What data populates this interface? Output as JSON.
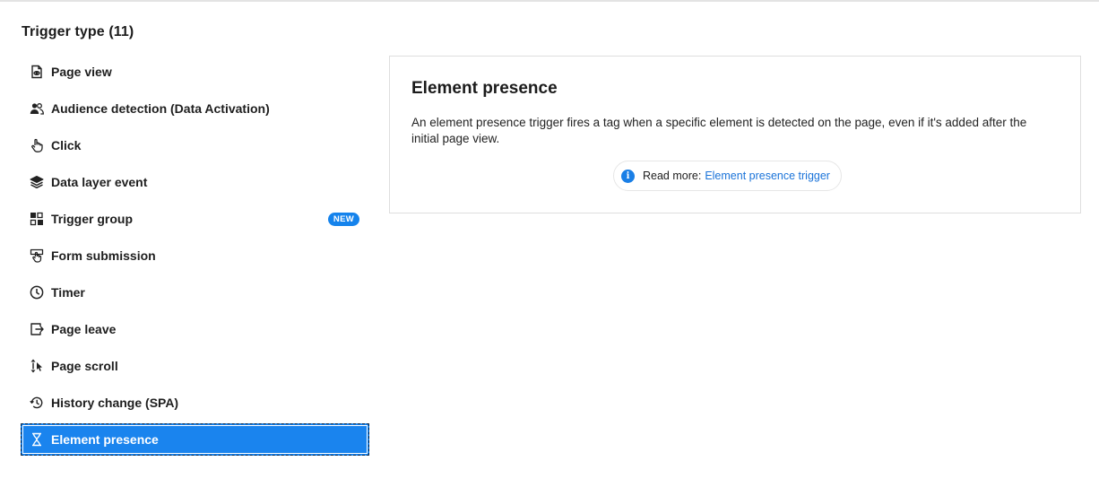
{
  "header": {
    "title": "Trigger type (11)"
  },
  "triggers": [
    {
      "label": "Page view",
      "icon": "page-view-icon",
      "selected": false
    },
    {
      "label": "Audience detection (Data Activation)",
      "icon": "audience-icon",
      "selected": false
    },
    {
      "label": "Click",
      "icon": "pointer-hand-icon",
      "selected": false
    },
    {
      "label": "Data layer event",
      "icon": "layers-icon",
      "selected": false
    },
    {
      "label": "Trigger group",
      "icon": "trigger-group-icon",
      "selected": false,
      "badge": "NEW"
    },
    {
      "label": "Form submission",
      "icon": "form-submit-icon",
      "selected": false
    },
    {
      "label": "Timer",
      "icon": "clock-icon",
      "selected": false
    },
    {
      "label": "Page leave",
      "icon": "exit-icon",
      "selected": false
    },
    {
      "label": "Page scroll",
      "icon": "scroll-icon",
      "selected": false
    },
    {
      "label": "History change (SPA)",
      "icon": "history-icon",
      "selected": false
    },
    {
      "label": "Element presence",
      "icon": "hourglass-icon",
      "selected": true
    }
  ],
  "detail": {
    "title": "Element presence",
    "description": "An element presence trigger fires a tag when a specific element is detected on the page, even if it's added after the initial page view.",
    "read_more_prefix": "Read more:",
    "read_more_link": "Element presence trigger"
  },
  "colors": {
    "accent": "#1a84ee",
    "link": "#1a73d9",
    "badge": "#1583ec"
  }
}
